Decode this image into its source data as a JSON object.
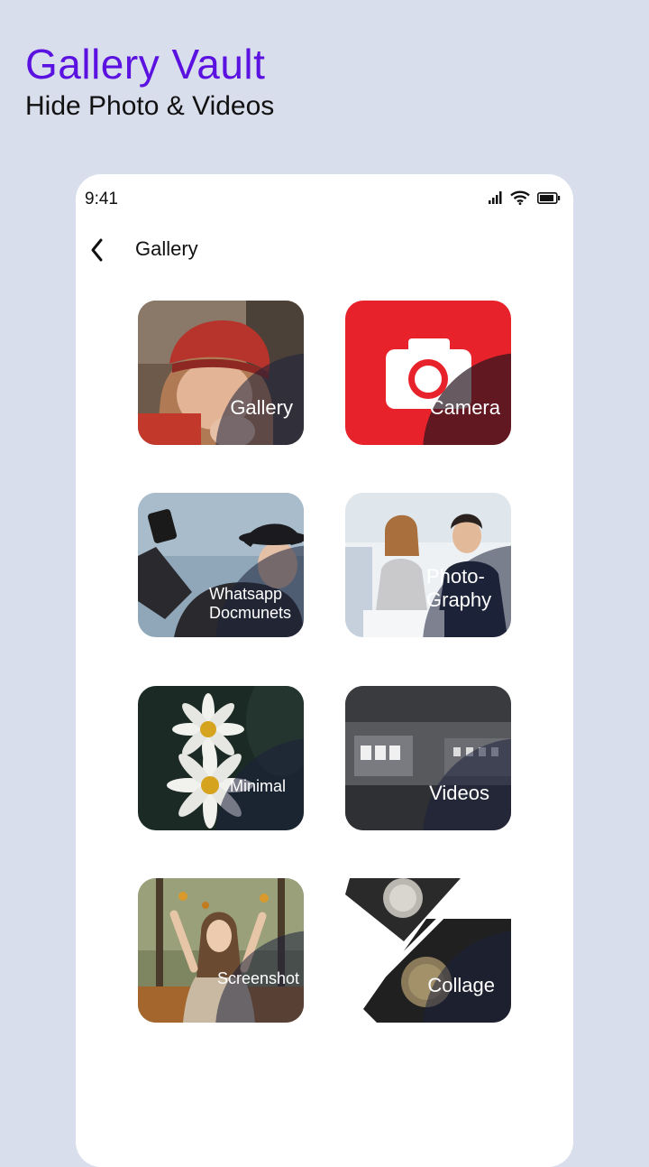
{
  "promo": {
    "title": "Gallery Vault",
    "subtitle": "Hide Photo & Videos"
  },
  "status_bar": {
    "time": "9:41",
    "icons": [
      "signal-icon",
      "wifi-icon",
      "battery-icon"
    ]
  },
  "app_bar": {
    "title": "Gallery"
  },
  "tiles": [
    {
      "label": "Gallery",
      "image": "woman-in-knit-hat"
    },
    {
      "label": "Camera",
      "image": "camera-icon-on-red"
    },
    {
      "label": "Whatsapp Docmunets",
      "image": "woman-taking-selfie"
    },
    {
      "label": "Photo- Graphy",
      "image": "business-team-meeting"
    },
    {
      "label": "Minimal",
      "image": "white-daisies-dark-background"
    },
    {
      "label": "Videos",
      "image": "gallery-hall-interior"
    },
    {
      "label": "Screenshot",
      "image": "woman-throwing-leaves"
    },
    {
      "label": "Collage",
      "image": "wristwatch-collage"
    }
  ],
  "colors": {
    "background": "#d8deec",
    "brand_purple": "#5b12e0",
    "camera_red": "#e8222b"
  }
}
